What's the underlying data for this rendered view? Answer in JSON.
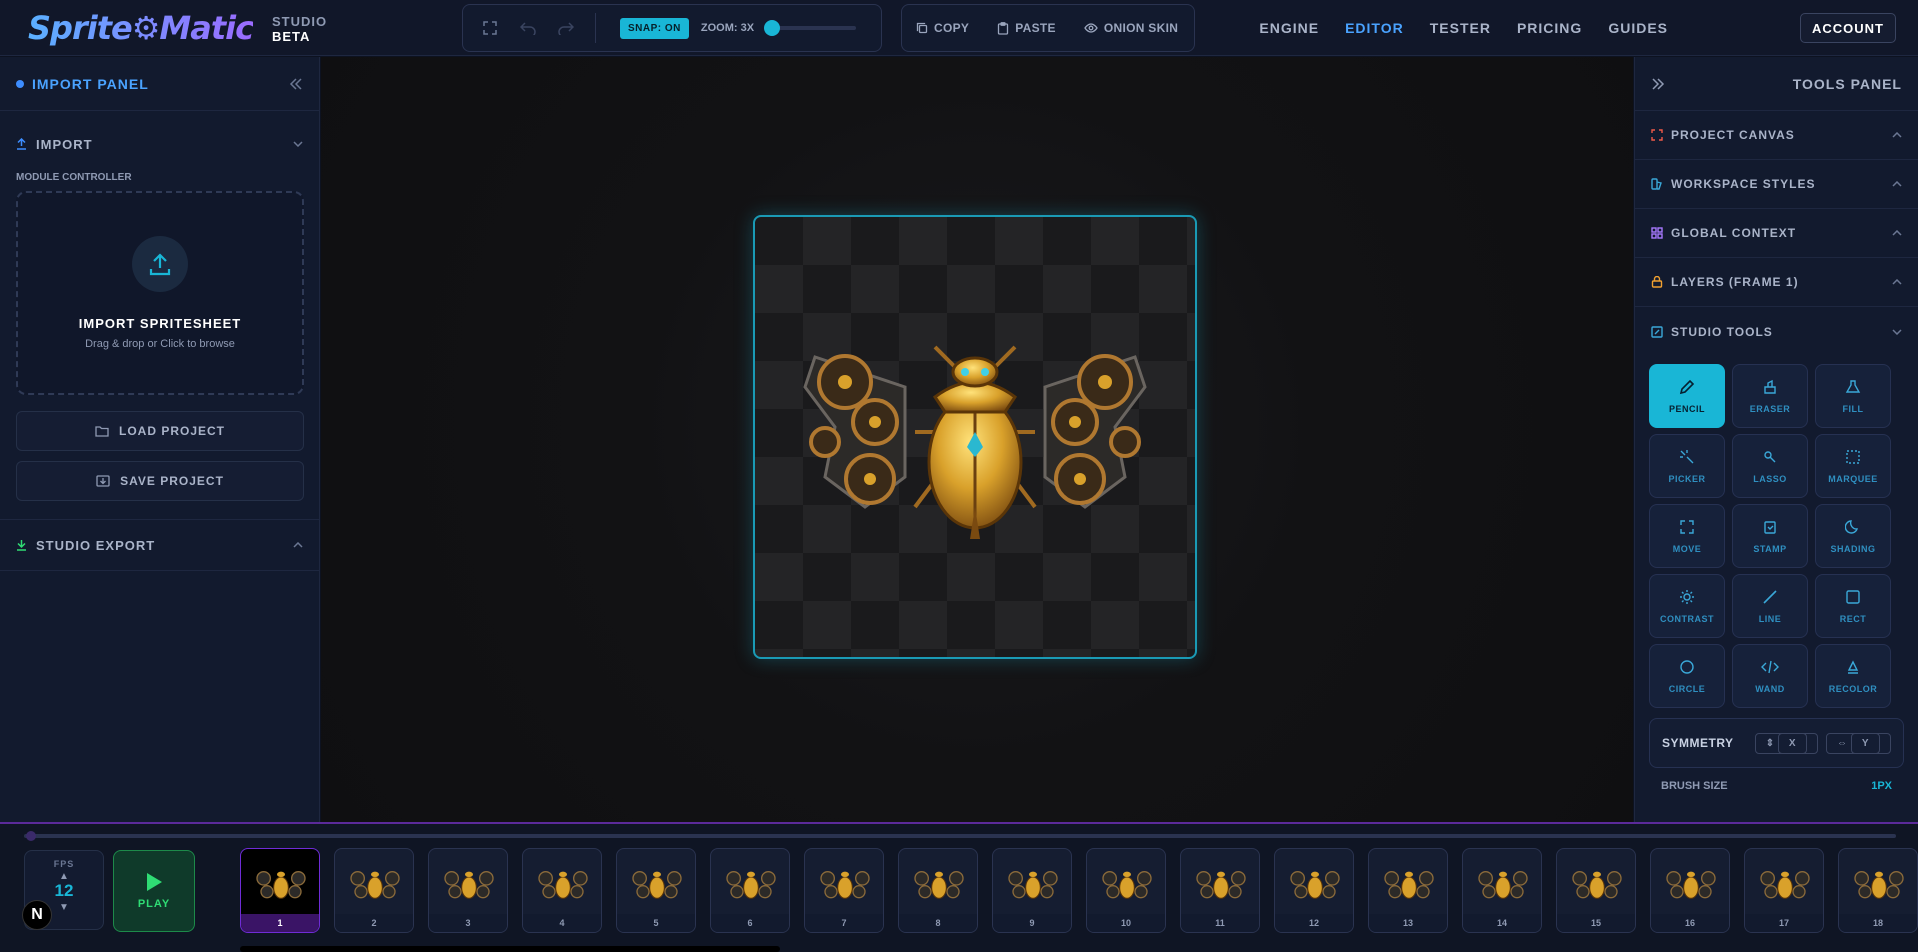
{
  "header": {
    "logo": "Sprite⚙Matic",
    "studio": "STUDIO",
    "beta": "BETA",
    "snap": "SNAP: ON",
    "zoom": "ZOOM: 3X",
    "zoom_level": 0.0,
    "copy": "COPY",
    "paste": "PASTE",
    "onion": "ONION SKIN",
    "nav": [
      "ENGINE",
      "EDITOR",
      "TESTER",
      "PRICING",
      "GUIDES"
    ],
    "active_nav": "EDITOR",
    "account": "ACCOUNT"
  },
  "left_panel": {
    "title": "IMPORT PANEL",
    "import_section": "IMPORT",
    "module_controller": "MODULE CONTROLLER",
    "dropzone_title": "IMPORT SPRITESHEET",
    "dropzone_hint": "Drag & drop or Click to browse",
    "load": "LOAD PROJECT",
    "save": "SAVE PROJECT",
    "export_section": "STUDIO EXPORT"
  },
  "right_panel": {
    "title": "TOOLS PANEL",
    "sections": [
      {
        "label": "PROJECT CANVAS",
        "icon": "canvas-icon",
        "color": "#f05a48"
      },
      {
        "label": "WORKSPACE STYLES",
        "icon": "palette-icon",
        "color": "#3aa8d8"
      },
      {
        "label": "GLOBAL CONTEXT",
        "icon": "grid-icon",
        "color": "#a779ff"
      },
      {
        "label": "LAYERS (FRAME 1)",
        "icon": "layers-icon",
        "color": "#f0a030"
      },
      {
        "label": "STUDIO TOOLS",
        "icon": "edit-icon",
        "color": "#3aa8d8"
      }
    ],
    "tools": [
      "PENCIL",
      "ERASER",
      "FILL",
      "PICKER",
      "LASSO",
      "MARQUEE",
      "MOVE",
      "STAMP",
      "SHADING",
      "CONTRAST",
      "LINE",
      "RECT",
      "CIRCLE",
      "WAND",
      "RECOLOR"
    ],
    "active_tool": "PENCIL",
    "symmetry": "SYMMETRY",
    "sym_x": "X",
    "sym_y": "Y",
    "brush_size": "BRUSH SIZE",
    "brush_value": "1PX"
  },
  "timeline": {
    "fps_label": "FPS",
    "fps_value": "12",
    "play": "PLAY",
    "frames": [
      "1",
      "2",
      "3",
      "4",
      "5",
      "6",
      "7",
      "8",
      "9",
      "10",
      "11",
      "12",
      "13",
      "14",
      "15",
      "16",
      "17",
      "18"
    ],
    "selected_frame": "1"
  },
  "colors": {
    "accent": "#19b6d6",
    "brand": "#4aa3ff",
    "play": "#2fdc74",
    "selected_frame": "#6f2cd6"
  }
}
